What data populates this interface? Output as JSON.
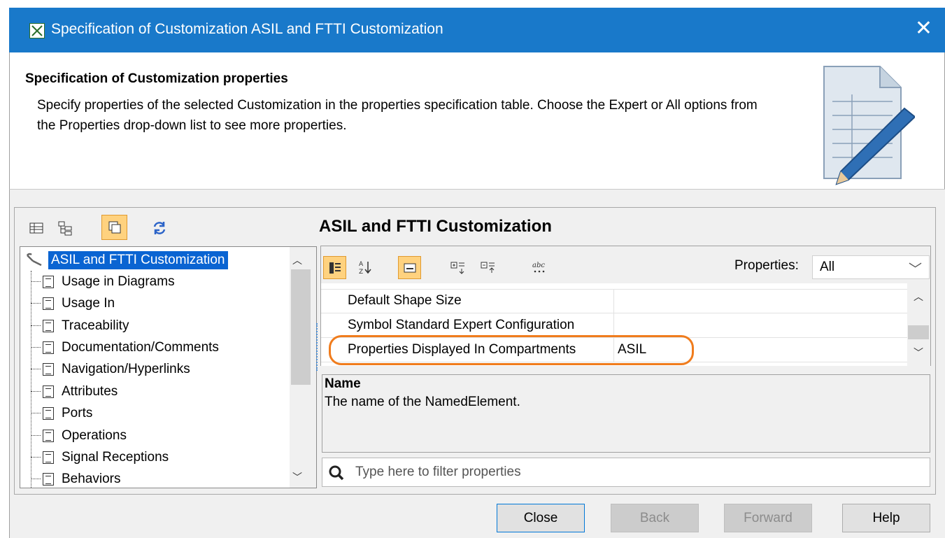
{
  "window": {
    "title": "Specification of Customization ASIL and FTTI Customization",
    "close_glyph": "✕"
  },
  "header": {
    "title": "Specification of Customization properties",
    "description": "Specify properties of the selected Customization in the properties specification table. Choose the Expert or All options from the Properties drop-down list to see more properties."
  },
  "tree": {
    "root": "ASIL and FTTI Customization",
    "items": [
      "Usage in Diagrams",
      "Usage In",
      "Traceability",
      "Documentation/Comments",
      "Navigation/Hyperlinks",
      "Attributes",
      "Ports",
      "Operations",
      "Signal Receptions",
      "Behaviors"
    ]
  },
  "element_title": "ASIL and FTTI Customization",
  "properties_filter": {
    "label": "Properties:",
    "selected": "All"
  },
  "property_rows": [
    {
      "name": "Default Shape Size",
      "value": ""
    },
    {
      "name": "Symbol Standard Expert Configuration",
      "value": ""
    },
    {
      "name": "Properties Displayed In Compartments",
      "value": "ASIL"
    }
  ],
  "description": {
    "title": "Name",
    "text": "The name of the NamedElement."
  },
  "filter_input": {
    "placeholder": "Type here to filter properties"
  },
  "buttons": {
    "close": "Close",
    "back": "Back",
    "forward": "Forward",
    "help": "Help"
  },
  "colors": {
    "titlebar": "#1979ca",
    "selection": "#0a64d2",
    "highlight": "#f07c1d",
    "active_tool": "#ffd27f"
  }
}
